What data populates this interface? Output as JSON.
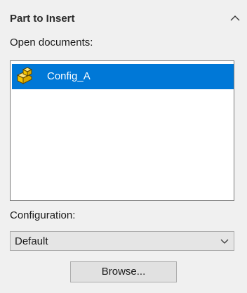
{
  "section": {
    "title": "Part to Insert",
    "collapse_icon": "chevron-up-icon"
  },
  "open_documents": {
    "label": "Open documents:",
    "items": [
      {
        "name": "Config_A",
        "icon": "part-icon",
        "selected": true
      }
    ]
  },
  "configuration": {
    "label": "Configuration:",
    "selected": "Default",
    "dropdown_icon": "chevron-down-icon"
  },
  "browse_button": {
    "label": "Browse..."
  },
  "colors": {
    "selection": "#0078d7",
    "panel_background": "#f0f0f0",
    "icon_yellow": "#f5c400"
  }
}
